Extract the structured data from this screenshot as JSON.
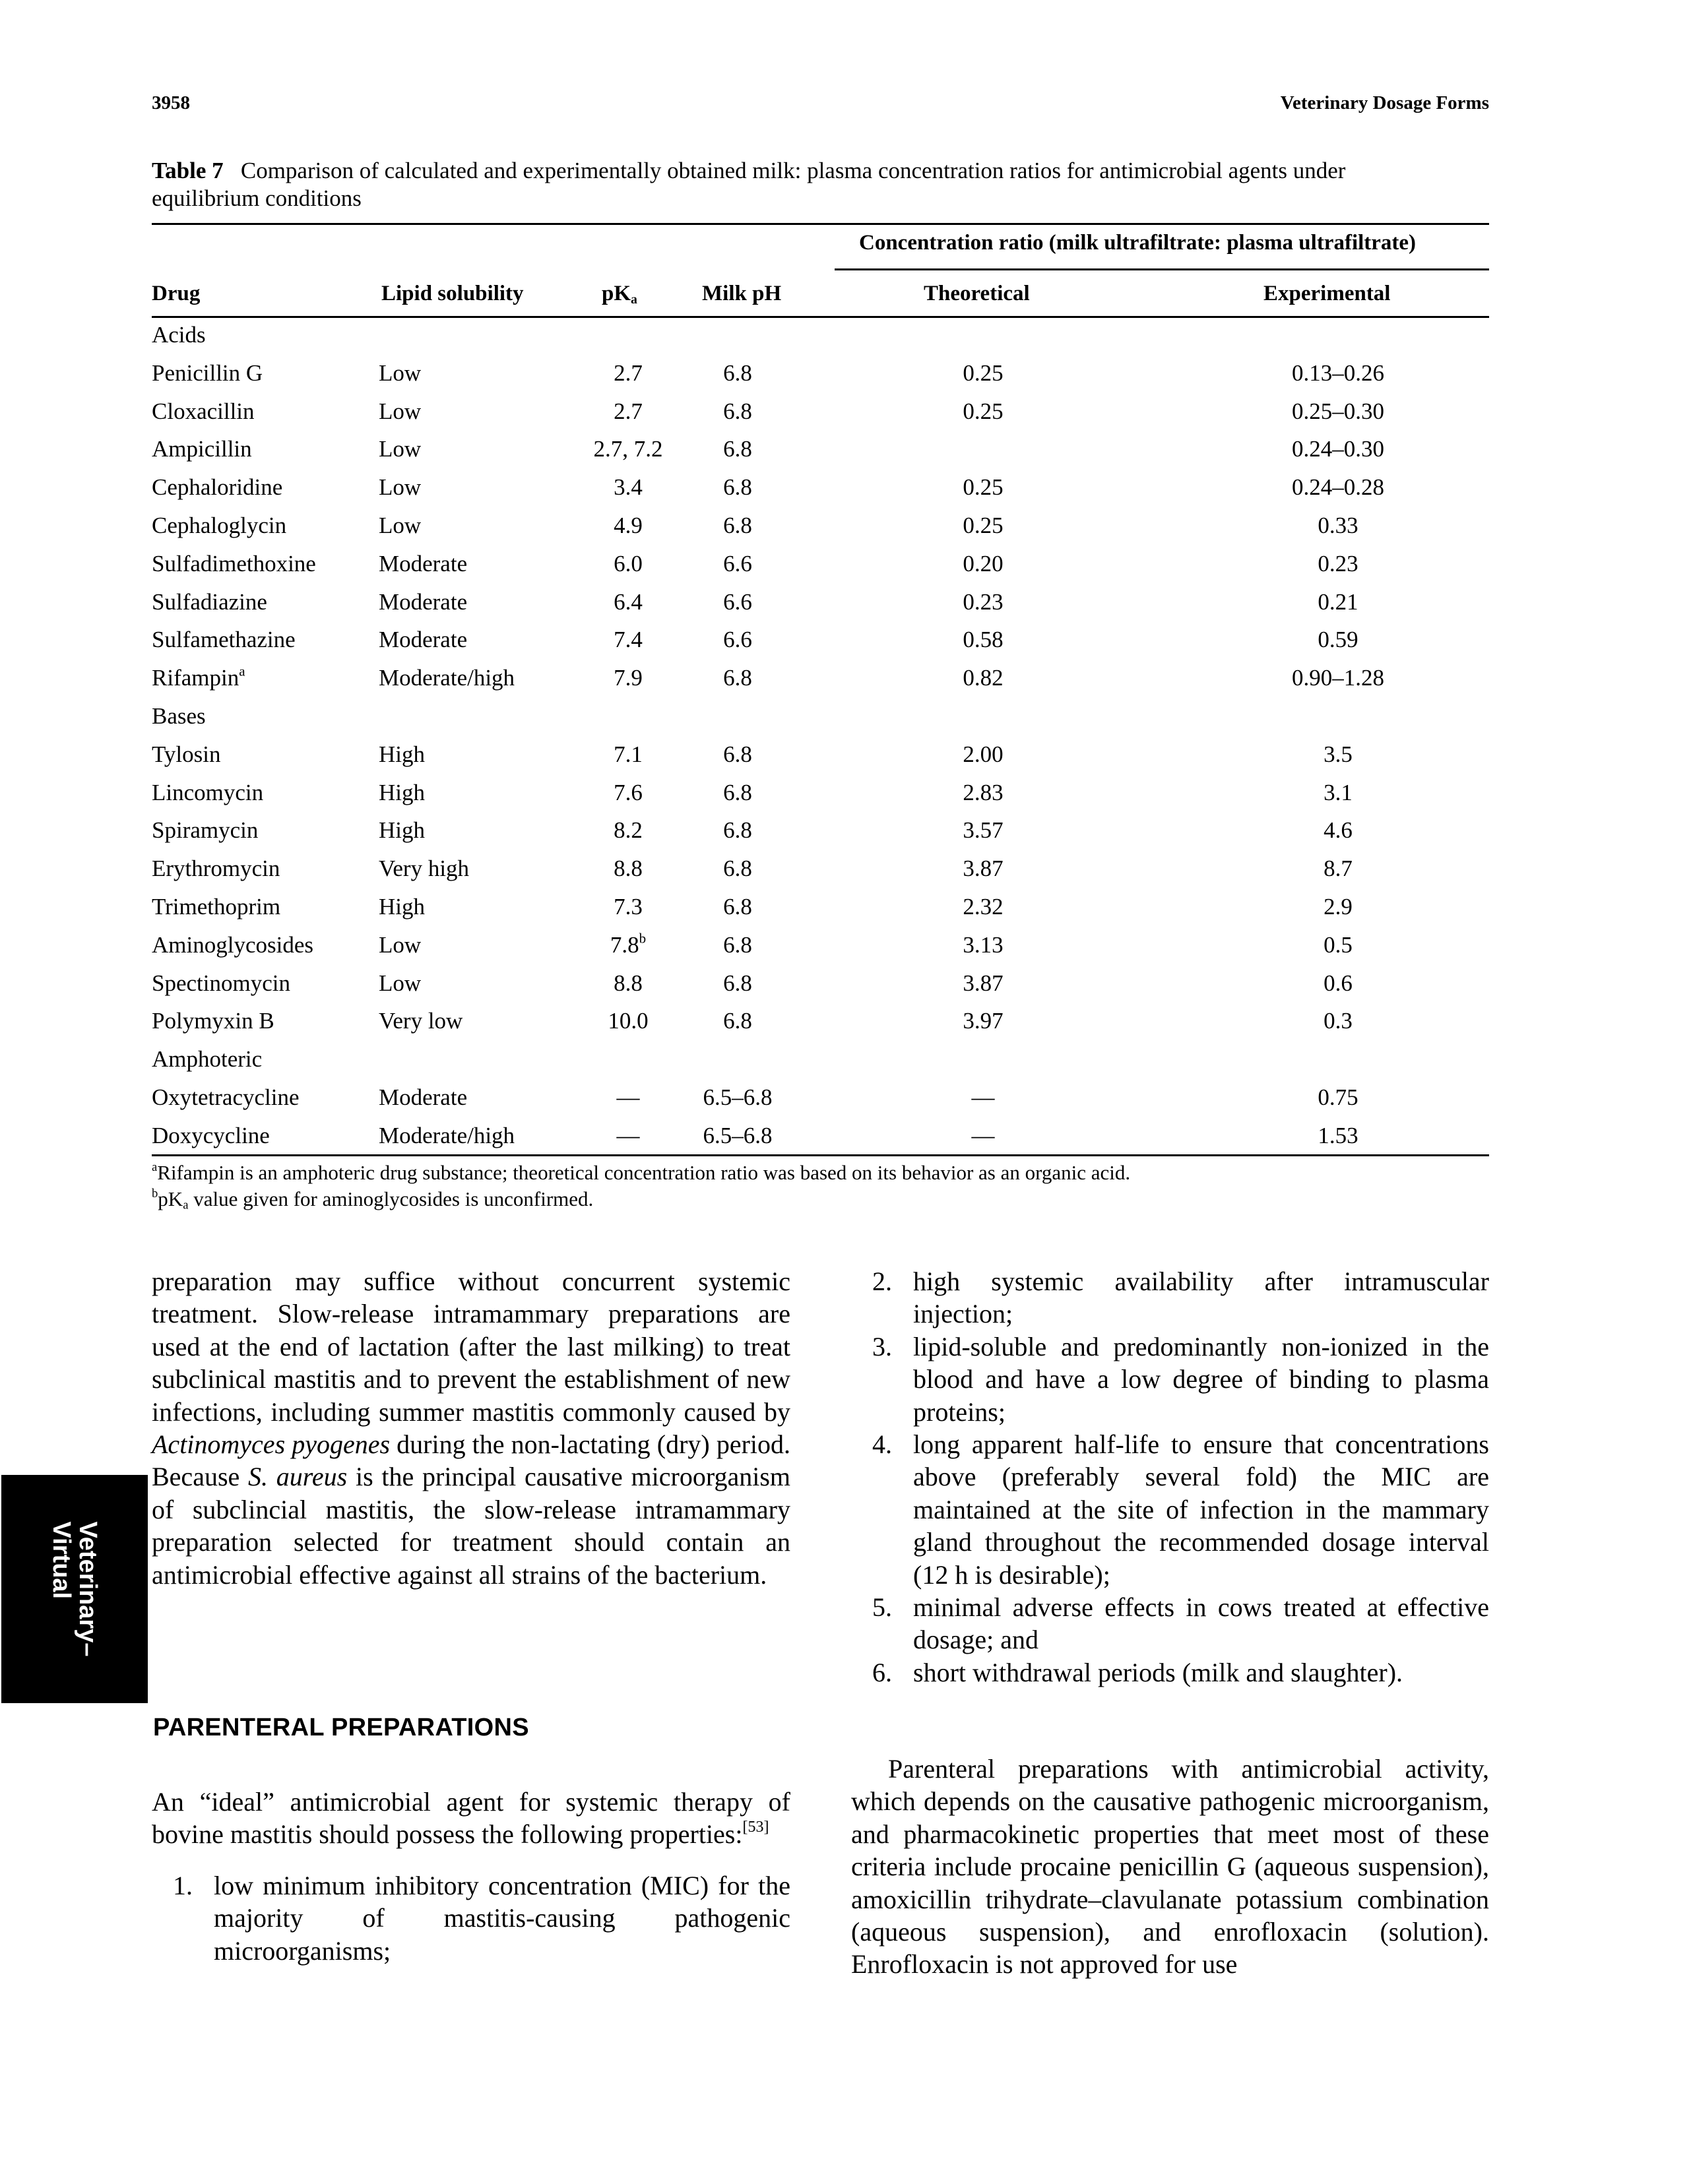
{
  "header": {
    "page_number": "3958",
    "running_title": "Veterinary Dosage Forms"
  },
  "table": {
    "label": "Table 7",
    "caption": "Comparison of calculated and experimentally obtained milk: plasma concentration ratios for antimicrobial agents under equilibrium conditions",
    "spanning_header": "Concentration ratio (milk ultrafiltrate: plasma ultrafiltrate)",
    "columns": {
      "drug": "Drug",
      "lipid": "Lipid solubility",
      "pka": "pK",
      "pka_sub": "a",
      "milk_ph": "Milk pH",
      "theoretical": "Theoretical",
      "experimental": "Experimental"
    },
    "rows": [
      {
        "group": "Acids"
      },
      {
        "drug": "Penicillin G",
        "lipid": "Low",
        "pka": "2.7",
        "milk_ph": "6.8",
        "theoretical": "0.25",
        "experimental": "0.13–0.26"
      },
      {
        "drug": "Cloxacillin",
        "lipid": "Low",
        "pka": "2.7",
        "milk_ph": "6.8",
        "theoretical": "0.25",
        "experimental": "0.25–0.30"
      },
      {
        "drug": "Ampicillin",
        "lipid": "Low",
        "pka": "2.7, 7.2",
        "milk_ph": "6.8",
        "theoretical": "",
        "experimental": "0.24–0.30"
      },
      {
        "drug": "Cephaloridine",
        "lipid": "Low",
        "pka": "3.4",
        "milk_ph": "6.8",
        "theoretical": "0.25",
        "experimental": "0.24–0.28"
      },
      {
        "drug": "Cephaloglycin",
        "lipid": "Low",
        "pka": "4.9",
        "milk_ph": "6.8",
        "theoretical": "0.25",
        "experimental": "0.33"
      },
      {
        "drug": "Sulfadimethoxine",
        "lipid": "Moderate",
        "pka": "6.0",
        "milk_ph": "6.6",
        "theoretical": "0.20",
        "experimental": "0.23"
      },
      {
        "drug": "Sulfadiazine",
        "lipid": "Moderate",
        "pka": "6.4",
        "milk_ph": "6.6",
        "theoretical": "0.23",
        "experimental": "0.21"
      },
      {
        "drug": "Sulfamethazine",
        "lipid": "Moderate",
        "pka": "7.4",
        "milk_ph": "6.6",
        "theoretical": "0.58",
        "experimental": "0.59"
      },
      {
        "drug": "Rifampin",
        "drug_sup": "a",
        "lipid": "Moderate/high",
        "pka": "7.9",
        "milk_ph": "6.8",
        "theoretical": "0.82",
        "experimental": "0.90–1.28"
      },
      {
        "group": "Bases"
      },
      {
        "drug": "Tylosin",
        "lipid": "High",
        "pka": "7.1",
        "milk_ph": "6.8",
        "theoretical": "2.00",
        "experimental": "3.5"
      },
      {
        "drug": "Lincomycin",
        "lipid": "High",
        "pka": "7.6",
        "milk_ph": "6.8",
        "theoretical": "2.83",
        "experimental": "3.1"
      },
      {
        "drug": "Spiramycin",
        "lipid": "High",
        "pka": "8.2",
        "milk_ph": "6.8",
        "theoretical": "3.57",
        "experimental": "4.6"
      },
      {
        "drug": "Erythromycin",
        "lipid": "Very high",
        "pka": "8.8",
        "milk_ph": "6.8",
        "theoretical": "3.87",
        "experimental": "8.7"
      },
      {
        "drug": "Trimethoprim",
        "lipid": "High",
        "pka": "7.3",
        "milk_ph": "6.8",
        "theoretical": "2.32",
        "experimental": "2.9"
      },
      {
        "drug": "Aminoglycosides",
        "lipid": "Low",
        "pka": "7.8",
        "pka_sup": "b",
        "milk_ph": "6.8",
        "theoretical": "3.13",
        "experimental": "0.5"
      },
      {
        "drug": "Spectinomycin",
        "lipid": "Low",
        "pka": "8.8",
        "milk_ph": "6.8",
        "theoretical": "3.87",
        "experimental": "0.6"
      },
      {
        "drug": "Polymyxin B",
        "lipid": "Very low",
        "pka": "10.0",
        "milk_ph": "6.8",
        "theoretical": "3.97",
        "experimental": "0.3"
      },
      {
        "group": "Amphoteric"
      },
      {
        "drug": "Oxytetracycline",
        "lipid": "Moderate",
        "pka": "—",
        "milk_ph": "6.5–6.8",
        "theoretical": "—",
        "experimental": "0.75"
      },
      {
        "drug": "Doxycycline",
        "lipid": "Moderate/high",
        "pka": "—",
        "milk_ph": "6.5–6.8",
        "theoretical": "—",
        "experimental": "1.53"
      }
    ],
    "footnotes": [
      {
        "mark": "a",
        "text": "Rifampin is an amphoteric drug substance; theoretical concentration ratio was based on its  behavior as an organic acid."
      },
      {
        "mark": "b",
        "text_pre": "pK",
        "text_sub": "a",
        "text": " value given for aminoglycosides is unconfirmed."
      }
    ]
  },
  "left_column": {
    "para1_a": "preparation may suffice without concurrent systemic treatment. Slow-release intramammary preparations are used at the end of lactation (after the last milking) to treat subclinical mastitis and to prevent the establishment of new infections, including summer mastitis commonly caused by ",
    "para1_italic1": "Actinomyces pyogenes",
    "para1_b": " during the non-lactating (dry) period. Because ",
    "para1_italic2": "S. aureus",
    "para1_c": " is the principal causative microorganism of subclincial mastitis, the slow-release intramammary preparation selected for treatment should contain an antimicrobial effective against all strains of the bacterium.",
    "heading": "PARENTERAL PREPARATIONS",
    "para2": "An “ideal” antimicrobial agent for systemic therapy of bovine mastitis should possess the following properties:",
    "para2_ref": "[53]",
    "list": [
      {
        "num": "1.",
        "text": "low minimum inhibitory concentration (MIC) for the majority of mastitis-causing pathogenic microorganisms;"
      }
    ]
  },
  "right_column": {
    "list": [
      {
        "num": "2.",
        "text": "high systemic availability after intramuscular injection;"
      },
      {
        "num": "3.",
        "text": "lipid-soluble and predominantly non-ionized in the blood and have a low degree of binding to plasma proteins;"
      },
      {
        "num": "4.",
        "text": "long apparent half-life to ensure that concentrations above (preferably several fold) the MIC are maintained at the site of infection in the mammary gland throughout the recommended dosage interval (12 h is desirable);"
      },
      {
        "num": "5.",
        "text": "minimal adverse effects in cows treated at effective dosage; and"
      },
      {
        "num": "6.",
        "text": "short withdrawal periods (milk and slaughter)."
      }
    ],
    "para": "Parenteral preparations with antimicrobial activity, which depends on the causative pathogenic microorganism, and pharmacokinetic properties that meet most of these criteria include procaine penicillin G (aqueous suspension), amoxicillin trihydrate–clavulanate potassium combination (aqueous suspension), and enrofloxacin (solution). Enrofloxacin is not approved for use"
  },
  "side_tab": {
    "line1": "Veterinary–",
    "line2": "Virtual"
  }
}
